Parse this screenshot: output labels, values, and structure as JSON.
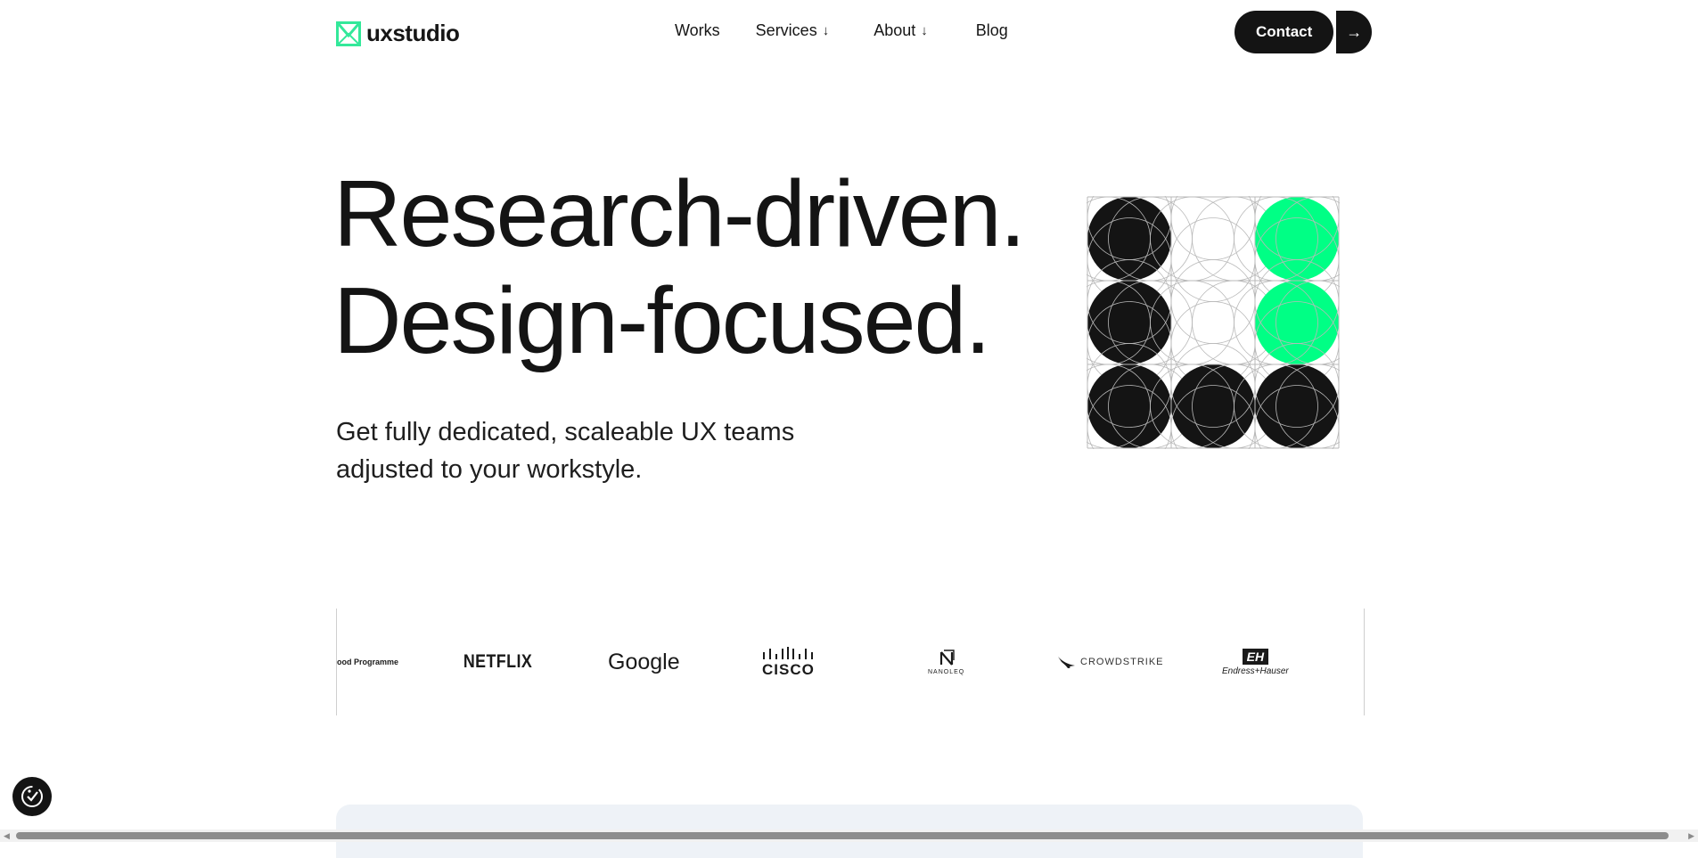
{
  "brand": {
    "name": "uxstudio",
    "accent": "#33e89a",
    "dark": "#141414",
    "green": "#00ff85"
  },
  "nav": {
    "works": "Works",
    "services": "Services",
    "about": "About",
    "blog": "Blog",
    "dropdown_icon": "arrow-down"
  },
  "contact": {
    "label": "Contact",
    "arrow_icon": "arrow-right",
    "arrow_glyph": "→"
  },
  "hero": {
    "line1": "Research-driven.",
    "line2": "Design-focused.",
    "subtitle_line1": "Get fully dedicated, scaleable UX teams",
    "subtitle_line2": "adjusted to your workstyle."
  },
  "clients": {
    "wfp": "ood Programme",
    "netflix": "NETFLIX",
    "google": "Google",
    "cisco": "CISCO",
    "nanoleq": "NANOLEQ",
    "crowdstrike": "CROWDSTRIKE",
    "endress_badge": "EH",
    "endress": "Endress+Hauser"
  },
  "grid_art": {
    "colors": {
      "black": "#141414",
      "green": "#00ff85",
      "line": "#b9b9b9"
    },
    "cells": [
      [
        "black",
        "white",
        "green"
      ],
      [
        "black",
        "white",
        "green"
      ],
      [
        "black",
        "black",
        "black"
      ]
    ]
  }
}
